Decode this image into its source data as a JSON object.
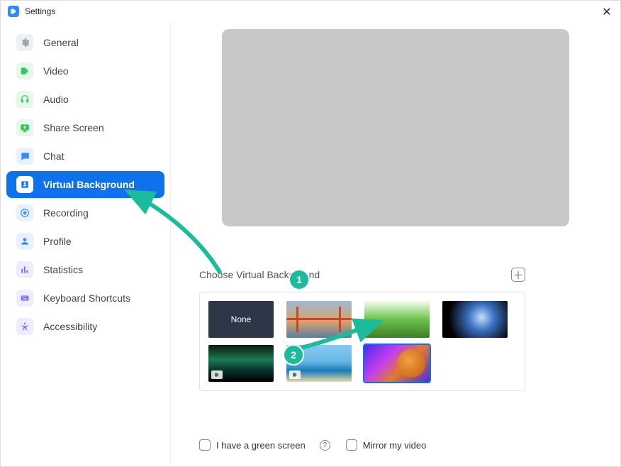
{
  "window": {
    "title": "Settings"
  },
  "sidebar": {
    "items": [
      {
        "label": "General"
      },
      {
        "label": "Video"
      },
      {
        "label": "Audio"
      },
      {
        "label": "Share Screen"
      },
      {
        "label": "Chat"
      },
      {
        "label": "Virtual Background"
      },
      {
        "label": "Recording"
      },
      {
        "label": "Profile"
      },
      {
        "label": "Statistics"
      },
      {
        "label": "Keyboard Shortcuts"
      },
      {
        "label": "Accessibility"
      }
    ],
    "active_index": 5
  },
  "main": {
    "choose_label": "Choose Virtual Background",
    "thumbs": {
      "none_label": "None"
    },
    "green_screen_label": "I have a green screen",
    "mirror_label": "Mirror my video"
  },
  "annotations": {
    "step1": "1",
    "step2": "2"
  }
}
